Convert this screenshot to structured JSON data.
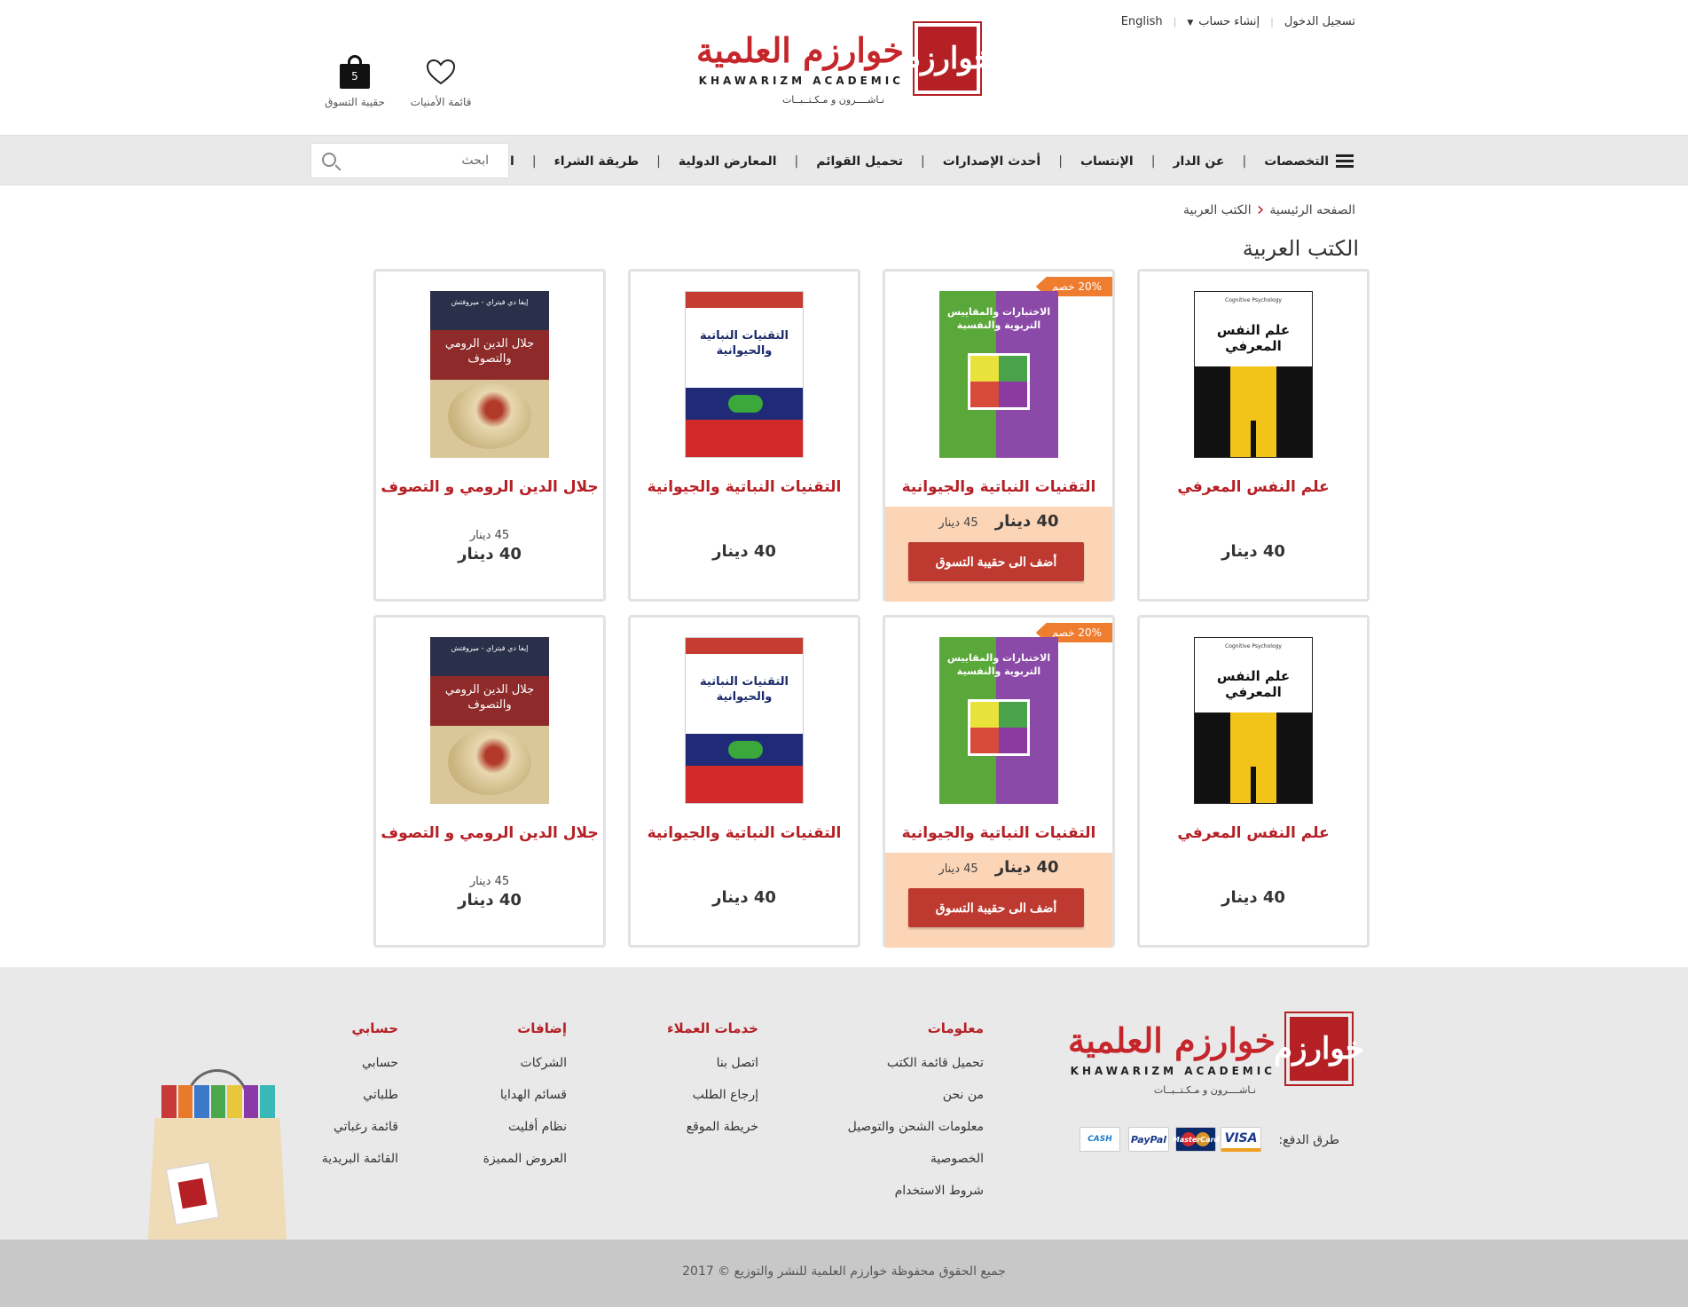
{
  "top_links": {
    "login": "تسجيل الدخول",
    "register": "إنشاء حساب",
    "language": "English"
  },
  "logo": {
    "mark": "خوارزم",
    "arabic": "خوارزم العلمية",
    "english": "KHAWARIZM ACADEMIC",
    "tagline": "نـاشــــرون و مـكـتــبــات"
  },
  "header": {
    "wishlist_label": "قائمة الأمنيات",
    "cart_label": "حقيبة التسوق",
    "cart_count": "5"
  },
  "nav": {
    "items": [
      {
        "label": "التخصصات"
      },
      {
        "label": "عن الدار"
      },
      {
        "label": "الإنتساب"
      },
      {
        "label": "أحدث الإصدارات"
      },
      {
        "label": "تحميل القوائم"
      },
      {
        "label": "المعارض الدولية"
      },
      {
        "label": "طريقة الشراء"
      },
      {
        "label": "اتصل بنا"
      }
    ],
    "separator": "|",
    "search_placeholder": "ابحث"
  },
  "breadcrumb": {
    "home": "الصفحه الرئيسية",
    "current": "الكتب العربية"
  },
  "page_title": "الكتب العربية",
  "products": [
    {
      "title": "علم النفس المعرفي",
      "price": "40 دينار",
      "old_price": "",
      "badge": "",
      "button": "",
      "cover": "bk1",
      "cover_text": "علم النفس المعرفي",
      "cover_tag": "Cognitive Psychology"
    },
    {
      "title": "التقنيات النباتية والجيوانية",
      "price": "40 دينار",
      "old_price": "45 دينار",
      "badge": "20% خصم",
      "button": "أضف الى حقيبة التسوق",
      "cover": "bk2",
      "cover_text": "الاختبارات والمقاييس التربوية والنفسية"
    },
    {
      "title": "التقنيات النباتية والجيوانية",
      "price": "40 دينار",
      "old_price": "",
      "badge": "",
      "button": "",
      "cover": "bk3",
      "cover_text": "التقنيات النباتية والحيوانية"
    },
    {
      "title": "جلال الدين الرومي و التصوف",
      "price": "40 دينار",
      "old_price": "45 دينار",
      "badge": "",
      "button": "",
      "cover": "bk4",
      "cover_text": "جلال الدين الرومي والتصوف",
      "cover_tag": "إيفا دي فيتراي - ميروفتش"
    },
    {
      "title": "علم النفس المعرفي",
      "price": "40 دينار",
      "old_price": "",
      "badge": "",
      "button": "",
      "cover": "bk1",
      "cover_text": "علم النفس المعرفي",
      "cover_tag": "Cognitive Psychology"
    },
    {
      "title": "التقنيات النباتية والجيوانية",
      "price": "40 دينار",
      "old_price": "45 دينار",
      "badge": "20% خصم",
      "button": "أضف الى حقيبة التسوق",
      "cover": "bk2",
      "cover_text": "الاختبارات والمقاييس التربوية والنفسية"
    },
    {
      "title": "التقنيات النباتية والجيوانية",
      "price": "40 دينار",
      "old_price": "",
      "badge": "",
      "button": "",
      "cover": "bk3",
      "cover_text": "التقنيات النباتية والحيوانية"
    },
    {
      "title": "جلال الدين الرومي و التصوف",
      "price": "40 دينار",
      "old_price": "45 دينار",
      "badge": "",
      "button": "",
      "cover": "bk4",
      "cover_text": "جلال الدين الرومي والتصوف",
      "cover_tag": "إيفا دي فيتراي - ميروفتش"
    }
  ],
  "footer": {
    "columns": [
      {
        "heading": "معلومات",
        "links": [
          "تحميل قائمة الكتب",
          "من نحن",
          "معلومات الشحن والتوصيل",
          "الخصوصية",
          "شروط الاستخدام"
        ]
      },
      {
        "heading": "خدمات العملاء",
        "links": [
          "اتصل بنا",
          "إرجاع الطلب",
          "خريطة الموقع"
        ]
      },
      {
        "heading": "إضافات",
        "links": [
          "الشركات",
          "قسائم الهدايا",
          "نظام أفليت",
          "العروض المميزة"
        ]
      },
      {
        "heading": "حسابي",
        "links": [
          "حسابي",
          "طلباتي",
          "قائمة رغباتي",
          "القائمة البريدية"
        ]
      }
    ],
    "payment_label": "طرق الدفع:",
    "payments": {
      "visa": "VISA",
      "mastercard": "MasterCard",
      "paypal": "PayPal",
      "cash": "CASH"
    },
    "copyright": "جميع الحقوق محفوظة خوارزم العلمية للنشر والتوزيع © 2017"
  },
  "colors": {
    "brand_red": "#b52025",
    "button_red": "#be3a30",
    "promo_bg": "#fcd4b6",
    "badge_orange": "#ee7d2f",
    "nav_bg": "#e9e9e9"
  }
}
